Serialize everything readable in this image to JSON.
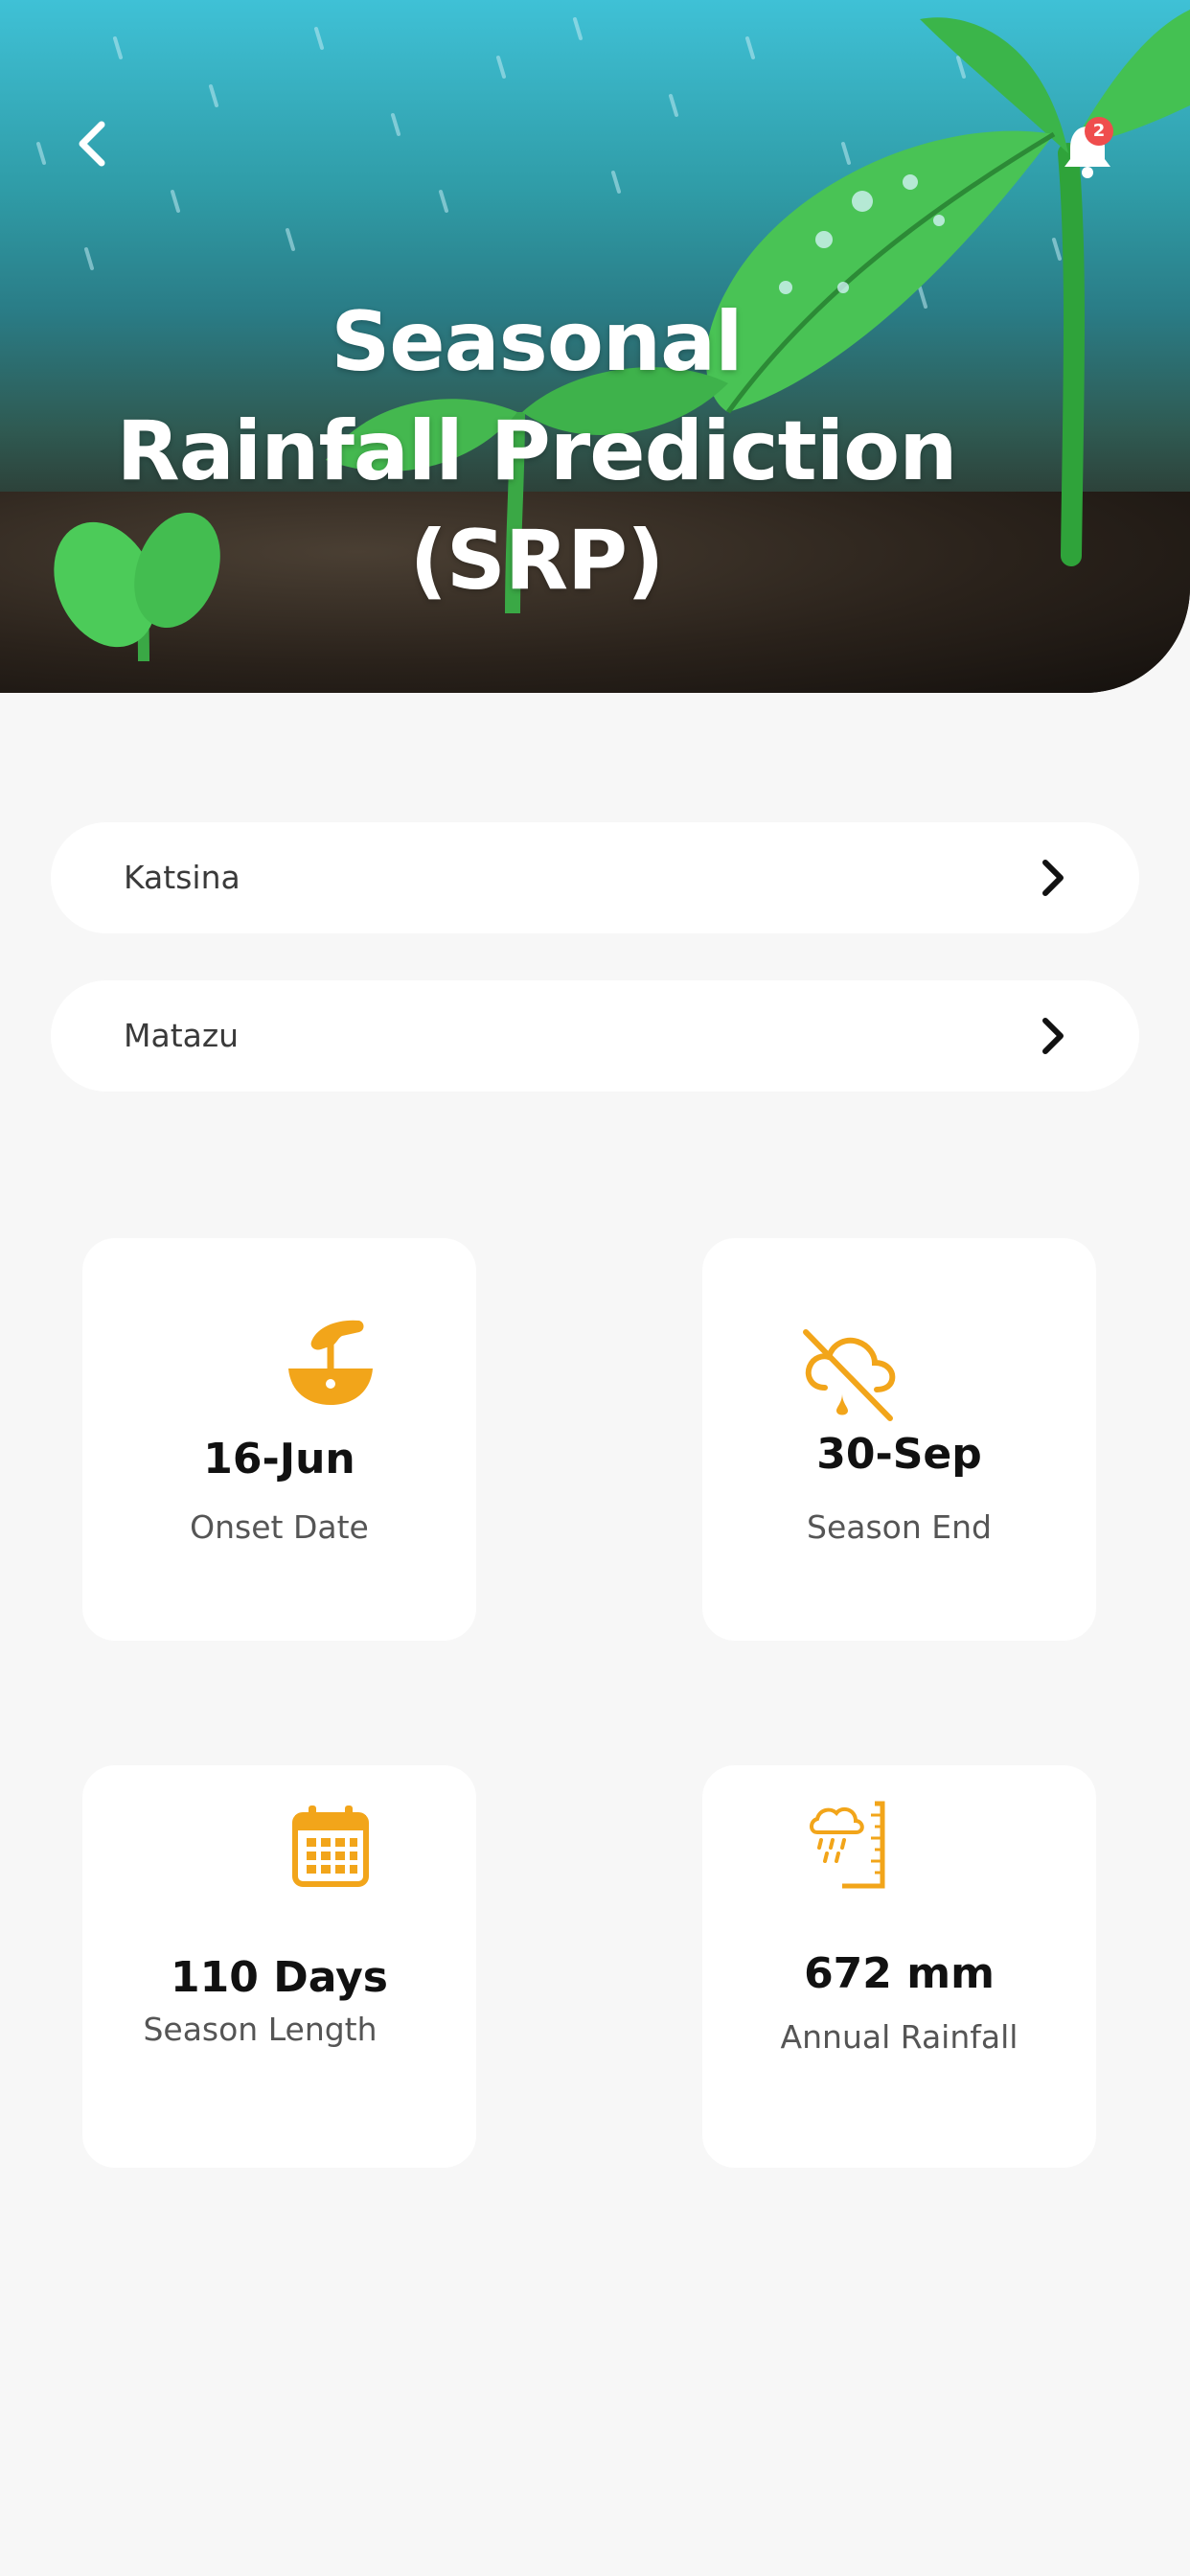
{
  "header": {
    "title_line1": "Seasonal",
    "title_line2": "Rainfall Prediction",
    "title_line3": "(SRP)",
    "notification_count": "2",
    "back_icon": "chevron-left-icon",
    "bell_icon": "bell-icon"
  },
  "filters": {
    "state": "Katsina",
    "lga": "Matazu"
  },
  "stats": [
    {
      "value": "16-Jun",
      "label": "Onset Date",
      "icon": "seed-planting-icon"
    },
    {
      "value": "30-Sep",
      "label": "Season End",
      "icon": "no-rain-cloud-icon"
    },
    {
      "value": "110 Days",
      "label": "Season Length",
      "icon": "calendar-icon"
    },
    {
      "value": "672 mm",
      "label": "Annual Rainfall",
      "icon": "rain-gauge-icon"
    }
  ],
  "colors": {
    "accent": "#f2a51a",
    "badge": "#ef4d4d",
    "background": "#f7f7f7"
  }
}
